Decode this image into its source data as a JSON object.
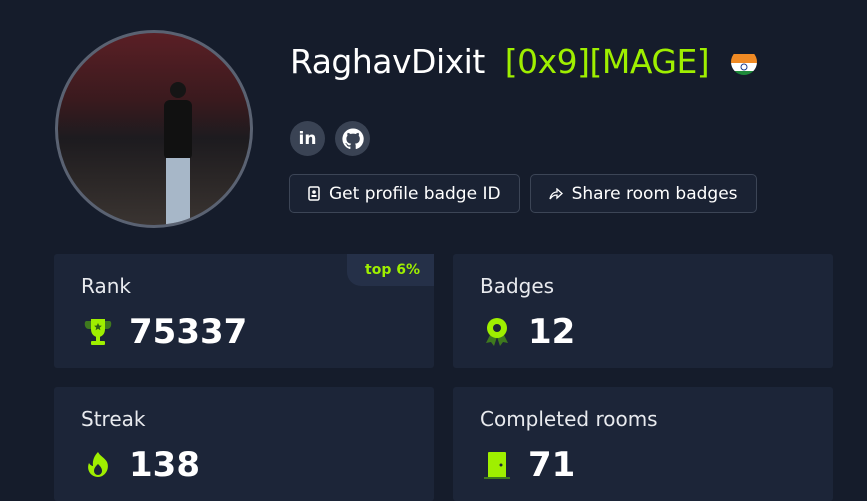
{
  "profile": {
    "username": "RaghavDixit",
    "tag": "[0x9][MAGE]",
    "country_flag": "india-flag-icon"
  },
  "social": [
    {
      "icon": "linkedin-icon",
      "label": "in"
    },
    {
      "icon": "github-icon"
    }
  ],
  "buttons": {
    "badge_id": "Get profile badge ID",
    "share": "Share room badges"
  },
  "stats": {
    "rank": {
      "label": "Rank",
      "value": "75337",
      "badge": "top 6%",
      "icon": "trophy-icon"
    },
    "badges": {
      "label": "Badges",
      "value": "12",
      "icon": "badge-icon"
    },
    "streak": {
      "label": "Streak",
      "value": "138",
      "icon": "flame-icon"
    },
    "rooms": {
      "label": "Completed rooms",
      "value": "71",
      "icon": "door-icon"
    }
  },
  "colors": {
    "accent": "#9fef00",
    "background": "#151c2b",
    "card": "#1c2538"
  }
}
